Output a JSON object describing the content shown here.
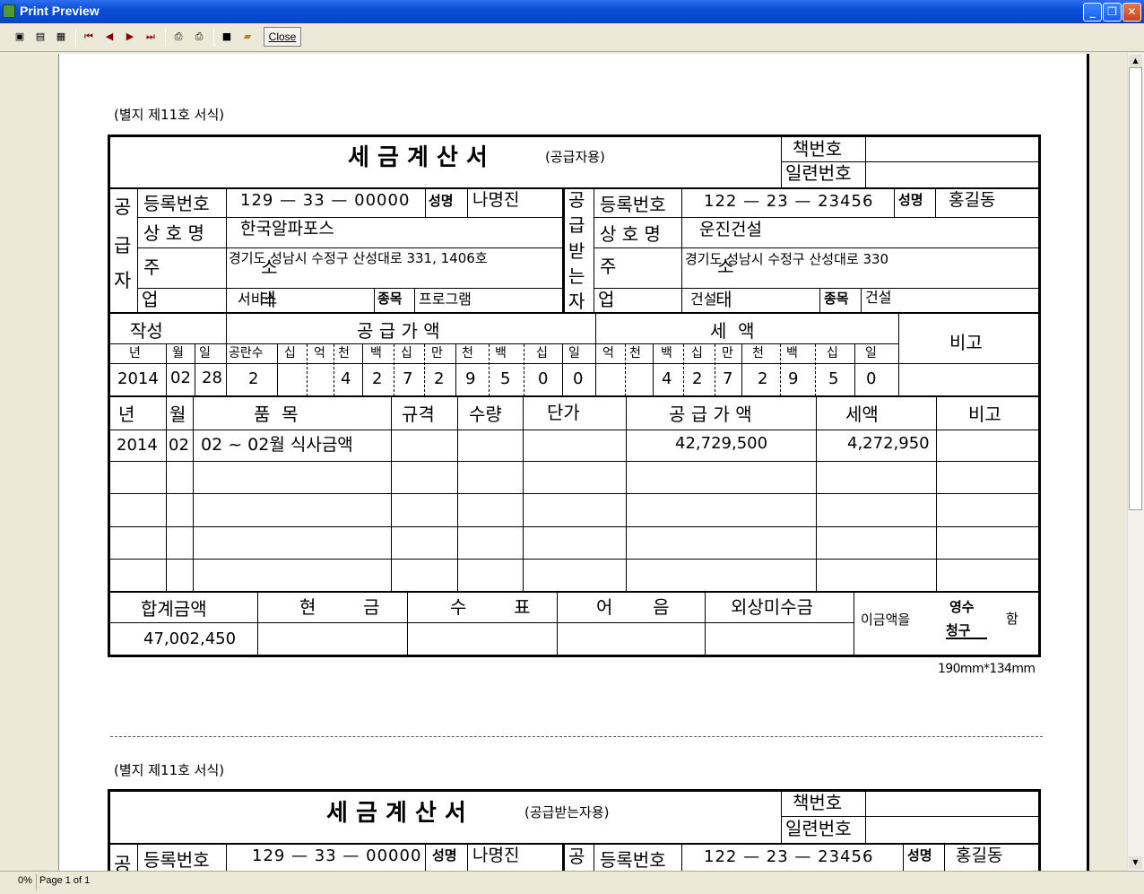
{
  "window": {
    "title": "Print Preview",
    "min_label": "_",
    "max_label": "❐",
    "close_label": "✕"
  },
  "toolbar": {
    "close_label": "Close"
  },
  "status": {
    "zoom": "0%",
    "page": "Page 1 of 1"
  },
  "invoice": {
    "form_no": "(별지 제11호 서식)",
    "title": "세 금 계 산 서",
    "copy_supplier": "(공급자용)",
    "copy_receiver": "(공급받는자용)",
    "book_label": "책번호",
    "serial_label": "일련번호",
    "supplier_side": [
      "공",
      "급",
      "자"
    ],
    "receiver_side": [
      "공",
      "급",
      "받",
      "는",
      "자"
    ],
    "reg_label": "등록번호",
    "name_label": "성명",
    "company_label": "상 호 명",
    "addr_label": "주  소",
    "biz_label": "업  태",
    "item_label": "종목",
    "supplier": {
      "reg": "129 — 33  — 00000",
      "name": "나명진",
      "company": "한국알파포스",
      "addr": "경기도 성남시 수정구 산성대로 331, 1406호",
      "biz": "서비스",
      "item": "프로그램"
    },
    "receiver": {
      "reg": "122 — 23  — 23456",
      "reg2": "122 —  23  — 23456",
      "name": "홍길동",
      "company": "운진건설",
      "addr": "경기도 성남시 수정구 산성대로 330",
      "biz": "건설",
      "item": "건설"
    },
    "written": "작성",
    "supply_amount": "공 급 가 액",
    "tax": "세  액",
    "note": "비고",
    "date_heads": [
      "년",
      "월",
      "일"
    ],
    "supply_digit_heads": [
      "공란수",
      "십",
      "억",
      "천",
      "백",
      "십",
      "만",
      "천",
      "백",
      "십",
      "일"
    ],
    "tax_digit_heads": [
      "억",
      "천",
      "백",
      "십",
      "만",
      "천",
      "백",
      "십",
      "일"
    ],
    "date": {
      "year": "2014",
      "month": "02",
      "day": "28"
    },
    "blank_count": "2",
    "supply_digits": [
      "4",
      "2",
      "7",
      "2",
      "9",
      "5",
      "0",
      "0"
    ],
    "tax_digits": [
      "4",
      "2",
      "7",
      "2",
      "9",
      "5",
      "0"
    ],
    "item_heads": {
      "year": "년",
      "month": "월",
      "item": "품  목",
      "spec": "규격",
      "qty": "수량",
      "price": "단가",
      "supply": "공 급 가 액",
      "tax": "세액",
      "note": "비고"
    },
    "line": {
      "year": "2014",
      "month": "02",
      "item": "02 ~ 02월 식사금액",
      "supply": "42,729,500",
      "tax": "4,272,950"
    },
    "total_label": "합계금액",
    "cash": "현  금",
    "check": "수  표",
    "bill": "어  음",
    "credit": "외상미수금",
    "total": "47,002,450",
    "amount_phrase": "이금액을",
    "receipt": "영수",
    "claim": "청구",
    "ham": "함",
    "size": "190mm*134mm"
  }
}
